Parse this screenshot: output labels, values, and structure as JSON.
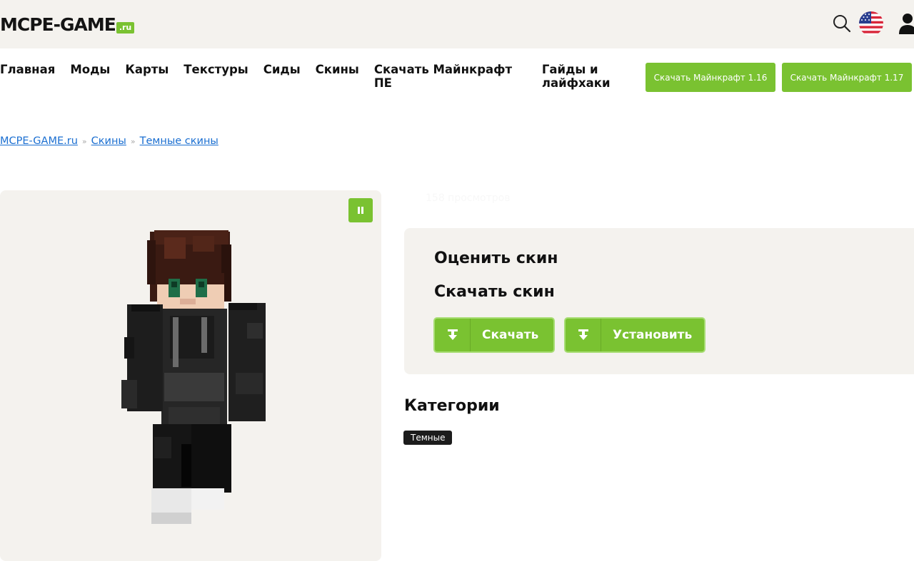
{
  "header": {
    "logo_text": "MCPE-GAME",
    "logo_suffix": ".ru",
    "icons": [
      "search-icon",
      "us-flag-icon",
      "user-icon"
    ]
  },
  "nav": {
    "items": [
      "Главная",
      "Моды",
      "Карты",
      "Текстуры",
      "Сиды",
      "Скины",
      "Скачать Майнкрафт ПЕ",
      "Гайды и лайфхаки"
    ],
    "download_buttons": [
      "Скачать Майнкрафт 1.16",
      "Скачать Майнкрафт 1.17"
    ]
  },
  "breadcrumb": {
    "items": [
      "MCPE-GAME.ru",
      "Скины",
      "Темные скины"
    ],
    "separator": "»"
  },
  "preview": {
    "pause_icon": "pause-icon"
  },
  "stats": {
    "views": "158 просмотров"
  },
  "actions": {
    "rate_title": "Оценить скин",
    "download_title": "Скачать скин",
    "download_label": "Скачать",
    "install_label": "Установить"
  },
  "categories": {
    "title": "Категории",
    "tags": [
      "Темные"
    ]
  },
  "colors": {
    "accent": "#7ac231",
    "panel_bg": "#f4f2ee",
    "link": "#1b6fd1",
    "tag_bg": "#1c1c1c"
  }
}
